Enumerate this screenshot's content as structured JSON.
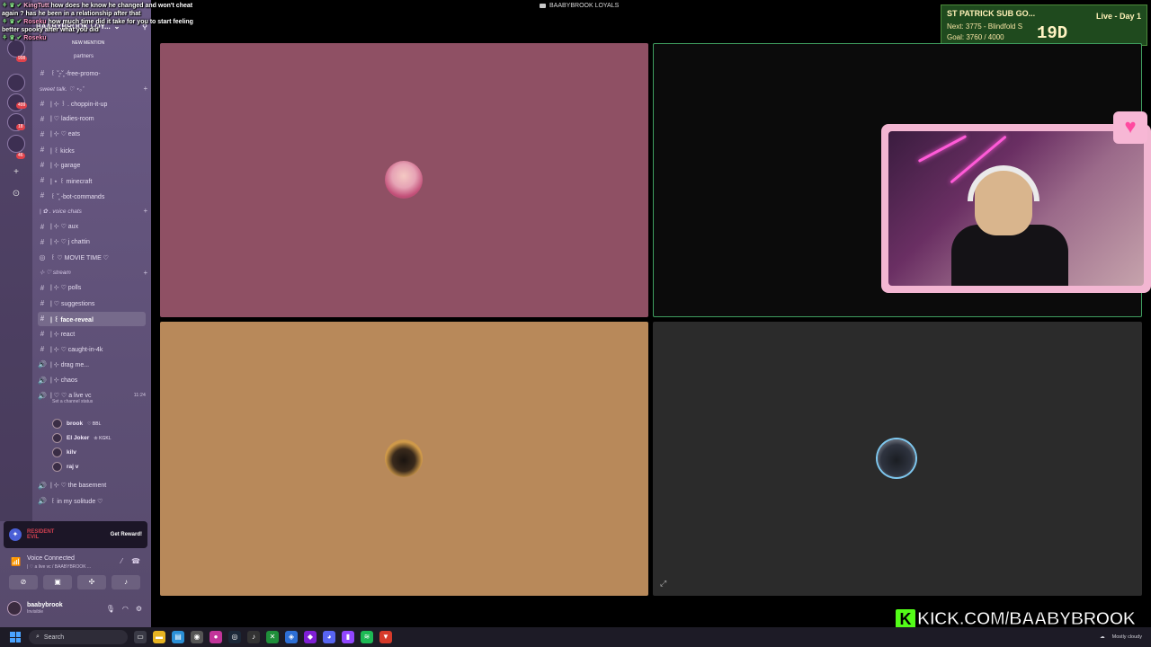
{
  "chat": [
    {
      "badges": "⚘ ♛ ✔",
      "user": "KingTutt",
      "message": "how does he know he changed and won't cheat again ? has he been in a relationship after that"
    },
    {
      "badges": "⚘ ♛ ✔",
      "user": "Roseku",
      "message": "how much time did it take for you to start feeling better spooky after what you did"
    },
    {
      "badges": "⚘ ♛ ✔",
      "user": "Roseku",
      "message": ""
    }
  ],
  "stream_title": "BAABYBROOK LOYALS",
  "server": {
    "name": "BAABYBROOK LOY...",
    "new_mention": "NEW MENTION",
    "partners": "partners",
    "rail_badges": [
      "998",
      "499",
      "18",
      "46"
    ]
  },
  "channels": [
    {
      "type": "text",
      "label": "꒰ ˘͈ᵕ˘͈ -free-promo-"
    },
    {
      "type": "category",
      "label": "sweet talk. ♡ ⋆｡˚"
    },
    {
      "type": "text",
      "label": "| ⊹ ꒱ . choppin-it-up"
    },
    {
      "type": "text",
      "label": "| ♡ ladies-room"
    },
    {
      "type": "text",
      "label": "| ⊹ ♡ eats"
    },
    {
      "type": "text",
      "label": "| ꒰ kicks"
    },
    {
      "type": "text",
      "label": "| ⊹ garage"
    },
    {
      "type": "text",
      "label": "| ⋆ ꒰ minecraft"
    },
    {
      "type": "text",
      "label": "꒰ ˘͈ -bot-commands"
    },
    {
      "type": "category",
      "label": "| ✿ . voice chats"
    },
    {
      "type": "text",
      "label": "| ⊹ ♡ aux"
    },
    {
      "type": "text",
      "label": "| ⊹ ♡ j chattin"
    },
    {
      "type": "stage",
      "label": "꒰ ♡ MOVIE TIME ♡"
    },
    {
      "type": "category",
      "label": "⊹ ♡ stream"
    },
    {
      "type": "text",
      "label": "| ⊹ ♡ polls"
    },
    {
      "type": "text",
      "label": "| ♡ suggestions"
    },
    {
      "type": "text",
      "label": "| ꒰ face-reveal",
      "active": true
    },
    {
      "type": "text",
      "label": "| ⊹ react"
    },
    {
      "type": "text",
      "label": "| ⊹ ♡ caught-in-4k"
    },
    {
      "type": "voice",
      "label": "| ⊹ drag me..."
    },
    {
      "type": "voice",
      "label": "| ⊹ chaos"
    },
    {
      "type": "voice",
      "label": "| ♡ ♡ a live vc",
      "time": "11:24",
      "status": "Set a channel status"
    }
  ],
  "members": [
    {
      "name": "brook",
      "tag": "♡ BBL"
    },
    {
      "name": "El Joker",
      "tag": "♔ KGKL"
    },
    {
      "name": "kilv",
      "tag": ""
    },
    {
      "name": "raj v",
      "tag": ""
    }
  ],
  "channels_after": [
    {
      "type": "voice",
      "label": "| ⊹ ♡ the basement"
    },
    {
      "type": "voice",
      "label": "꒰ in my solitude ♡"
    }
  ],
  "promo": {
    "brand": "RESIDENT EVIL",
    "button": "Get Reward!"
  },
  "voice": {
    "title": "Voice Connected",
    "channel": "| ♡ a live vc / BAABYBROOK ..."
  },
  "user": {
    "name": "baabybrook",
    "status": "Invisible"
  },
  "subgoal": {
    "title": "ST PATRICK SUB GO...",
    "day": "Live - Day 1",
    "next": "Next: 3775 - Blindfold S",
    "goal": "Goal: 3760 / 4000",
    "timer": "19D 05:54:28"
  },
  "kick": {
    "text": "KICK.COM/BAABYBROOK",
    "logo": "K",
    "accent": "#53fc18"
  },
  "taskbar": {
    "search": "Search",
    "weather": "Mostly cloudy"
  },
  "colors": {
    "tile_pink": "#8f5064",
    "tile_gold": "#b8895a",
    "tile_dark": "#2b2b2b",
    "speaking_border": "#3f9e5f",
    "sidebar": "#6b5a86"
  }
}
